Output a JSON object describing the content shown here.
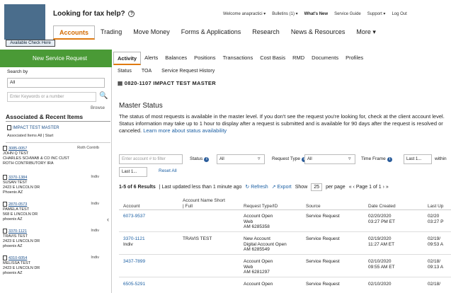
{
  "header": {
    "help_text": "Looking for tax help?",
    "help_icon": "?",
    "utils": [
      {
        "label": "Welcome anapractici ▾",
        "strong": false
      },
      {
        "label": "Bulletins (1) ▾",
        "strong": false
      },
      {
        "label": "What's New",
        "strong": true
      },
      {
        "label": "Service Guide",
        "strong": false
      },
      {
        "label": "Support ▾",
        "strong": false
      },
      {
        "label": "Log Out",
        "strong": false
      }
    ],
    "nav": [
      {
        "label": "Accounts",
        "active": true
      },
      {
        "label": "Trading",
        "active": false
      },
      {
        "label": "Move Money",
        "active": false
      },
      {
        "label": "Forms & Applications",
        "active": false
      },
      {
        "label": "Research",
        "active": false
      },
      {
        "label": "News & Resources",
        "active": false
      },
      {
        "label": "More ▾",
        "active": false
      }
    ],
    "account_check": "Available Check Here"
  },
  "new_service_request": "New Service Request",
  "subnav": [
    {
      "label": "Activity",
      "active": true
    },
    {
      "label": "Alerts",
      "active": false
    },
    {
      "label": "Balances",
      "active": false
    },
    {
      "label": "Positions",
      "active": false
    },
    {
      "label": "Transactions",
      "active": false
    },
    {
      "label": "Cost Basis",
      "active": false
    },
    {
      "label": "RMD",
      "active": false
    },
    {
      "label": "Documents",
      "active": false
    },
    {
      "label": "Profiles",
      "active": false
    }
  ],
  "left": {
    "search_by": "Search by",
    "search_select": "All",
    "search_placeholder": "Enter Keywords or a number",
    "browse": "Browse",
    "recent_title": "Associated & Recent Items",
    "master_link": "IMPACT TEST MASTER",
    "assoc_line": "Associated Items All | Start",
    "clients": [
      {
        "num": "3085-0057",
        "tag": "Roth Contrib",
        "lines": [
          "JOHN Q TEST",
          "CHARLES SCHWAB & CO INC CUST",
          "ROTH CONTRIBUTORY IRA"
        ]
      },
      {
        "num": "3370-1384",
        "tag": "Indiv",
        "lines": [
          "SUSAN TEST",
          "2423 E LINCOLN DR",
          "Phoenix AZ"
        ]
      },
      {
        "num": "2870-0573",
        "tag": "Indiv",
        "lines": [
          "PAMELA TEST",
          "568 E LINCOLN DR",
          "phoenix AZ"
        ]
      },
      {
        "num": "3370-1121",
        "tag": "Indiv",
        "lines": [
          "TRAVIS TEST",
          "2423 E LINCOLN DR",
          "phoenix AZ"
        ]
      },
      {
        "num": "4310-6054",
        "tag": "Indiv",
        "lines": [
          "MELISSA TEST",
          "2423 E LINCOLN DR",
          "phoenix AZ"
        ]
      }
    ]
  },
  "main": {
    "status_links": [
      "Status",
      "TOA",
      "Service Request History"
    ],
    "account_title": "0820-1107  IMPACT TEST MASTER",
    "master_status": "Master Status",
    "message": "The status of most requests is available in the master level. If you don't see the request you're looking for, check at the client account level. Status information may take up to 1 hour to display after a request is submitted and is available for 90 days after the request is resolved or canceled.",
    "learn_more": "Learn more about status availability",
    "filters": {
      "account_placeholder": "Enter account # to filter",
      "status_label": "Status",
      "status_value": "All",
      "request_type_label": "Request Type",
      "request_type_value": "All",
      "time_frame_label": "Time Frame",
      "time_frame_value": "Last 1...",
      "within": "within",
      "last_sel": "Last 1...",
      "reset": "Reset All"
    },
    "results": {
      "count": "1-5 of 6 Results",
      "updated": "| Last updated less than 1 minute ago",
      "refresh": "Refresh",
      "export": "Export",
      "show": "Show",
      "per_page_value": "25",
      "per_page": "per page",
      "pager": "«  ‹  Page 1 of 1  ›  »"
    },
    "table": {
      "headers": [
        "Account",
        "Account Name Short | Full",
        "Request Type/ID",
        "Source",
        "Date Created",
        "Last Up"
      ],
      "rows": [
        {
          "account": "6073-9537",
          "account_sub": "",
          "name": "",
          "request": [
            "Account Open",
            "Web",
            "AM 6285358"
          ],
          "source": "Service Request",
          "date": [
            "02/20/2020",
            "03:27 PM ET"
          ],
          "last": [
            "02/20",
            "03:27 P"
          ]
        },
        {
          "account": "3370-1121",
          "account_sub": "Indiv",
          "name": "TRAVIS TEST",
          "request": [
            "New Account",
            "Digital Account Open",
            "AM 6285549"
          ],
          "source": "Service Request",
          "date": [
            "02/19/2020",
            "11:27 AM ET"
          ],
          "last": [
            "02/19/",
            "09:53 A"
          ]
        },
        {
          "account": "3437-7899",
          "account_sub": "",
          "name": "",
          "request": [
            "Account Open",
            "Web",
            "AM 6281297"
          ],
          "source": "Service Request",
          "date": [
            "02/10/2020",
            "09:55 AM ET"
          ],
          "last": [
            "02/18/",
            "09:13 A"
          ]
        },
        {
          "account": "6505-5291",
          "account_sub": "",
          "name": "",
          "request": [
            "Account Open"
          ],
          "source": "Service Request",
          "date": [
            "02/10/2020"
          ],
          "last": [
            "02/18/"
          ]
        }
      ]
    }
  }
}
